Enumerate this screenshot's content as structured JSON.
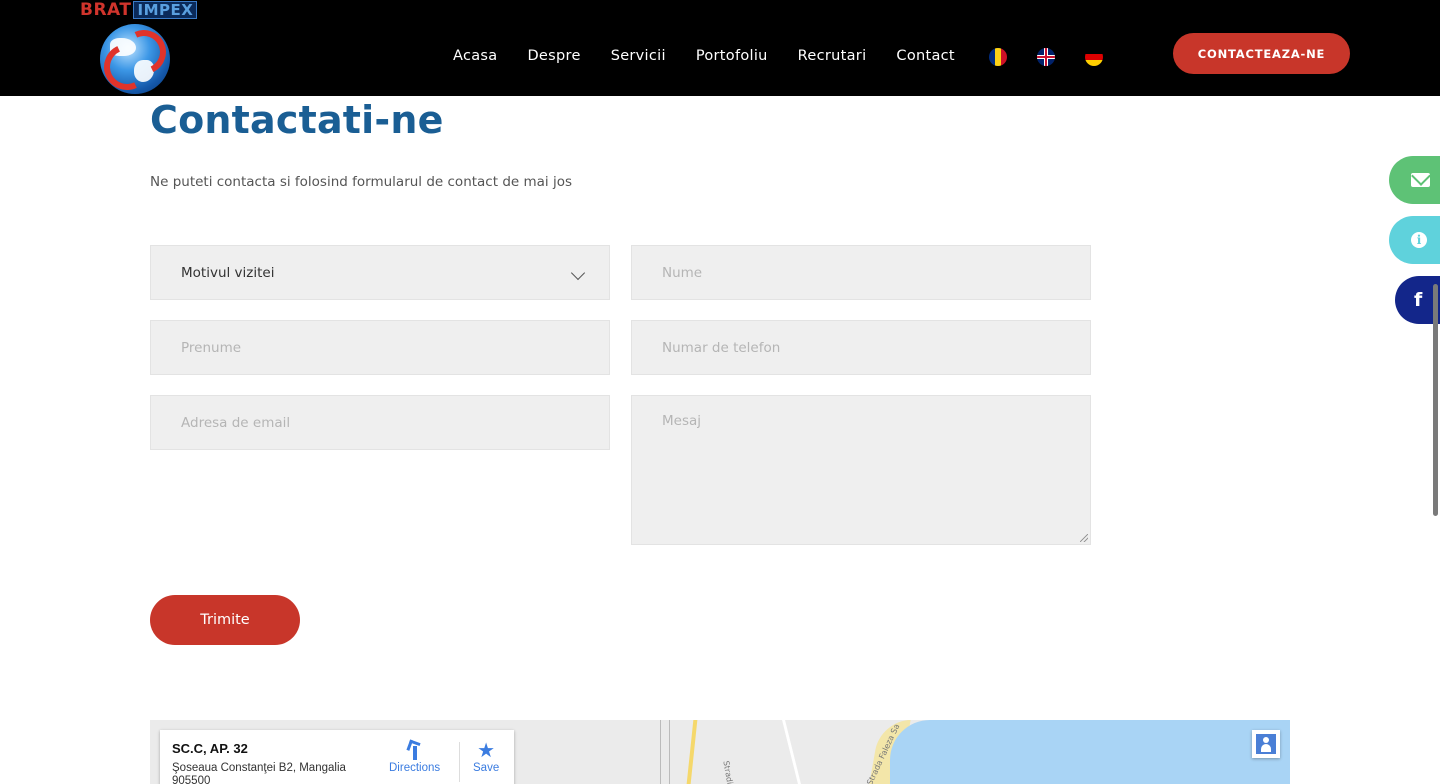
{
  "header": {
    "logo": {
      "brand_left": "BRAT",
      "brand_right": "IMPEX"
    },
    "nav": [
      {
        "label": "Acasa"
      },
      {
        "label": "Despre"
      },
      {
        "label": "Servicii"
      },
      {
        "label": "Portofoliu"
      },
      {
        "label": "Recrutari"
      },
      {
        "label": "Contact"
      }
    ],
    "flags": [
      "romanian-flag-icon",
      "english-flag-icon",
      "german-flag-icon"
    ],
    "cta_label": "CONTACTEAZA-NE"
  },
  "main": {
    "title": "Contactati-ne",
    "subtitle": "Ne puteti contacta si folosind formularul de contact de mai jos"
  },
  "form": {
    "reason_select": {
      "value": "Motivul vizitei"
    },
    "name_placeholder": "Nume",
    "first_name_placeholder": "Prenume",
    "phone_placeholder": "Numar de telefon",
    "email_placeholder": "Adresa de email",
    "message_placeholder": "Mesaj",
    "submit_label": "Trimite"
  },
  "side_buttons": [
    "envelope-icon",
    "info-icon",
    "facebook-icon"
  ],
  "map": {
    "place_title": "SC.C, AP. 32",
    "place_address": "Şoseaua Constanţei B2, Mangalia 905500",
    "directions_label": "Directions",
    "save_label": "Save",
    "street_labels": [
      "Strada Faleza Sa",
      "Stradi"
    ]
  },
  "colors": {
    "header_bg": "#000000",
    "accent_red": "#c8362a",
    "title_blue": "#1a5e94",
    "email_green": "#5ec276",
    "info_cyan": "#5fd2dc",
    "facebook_blue": "#13268a"
  }
}
